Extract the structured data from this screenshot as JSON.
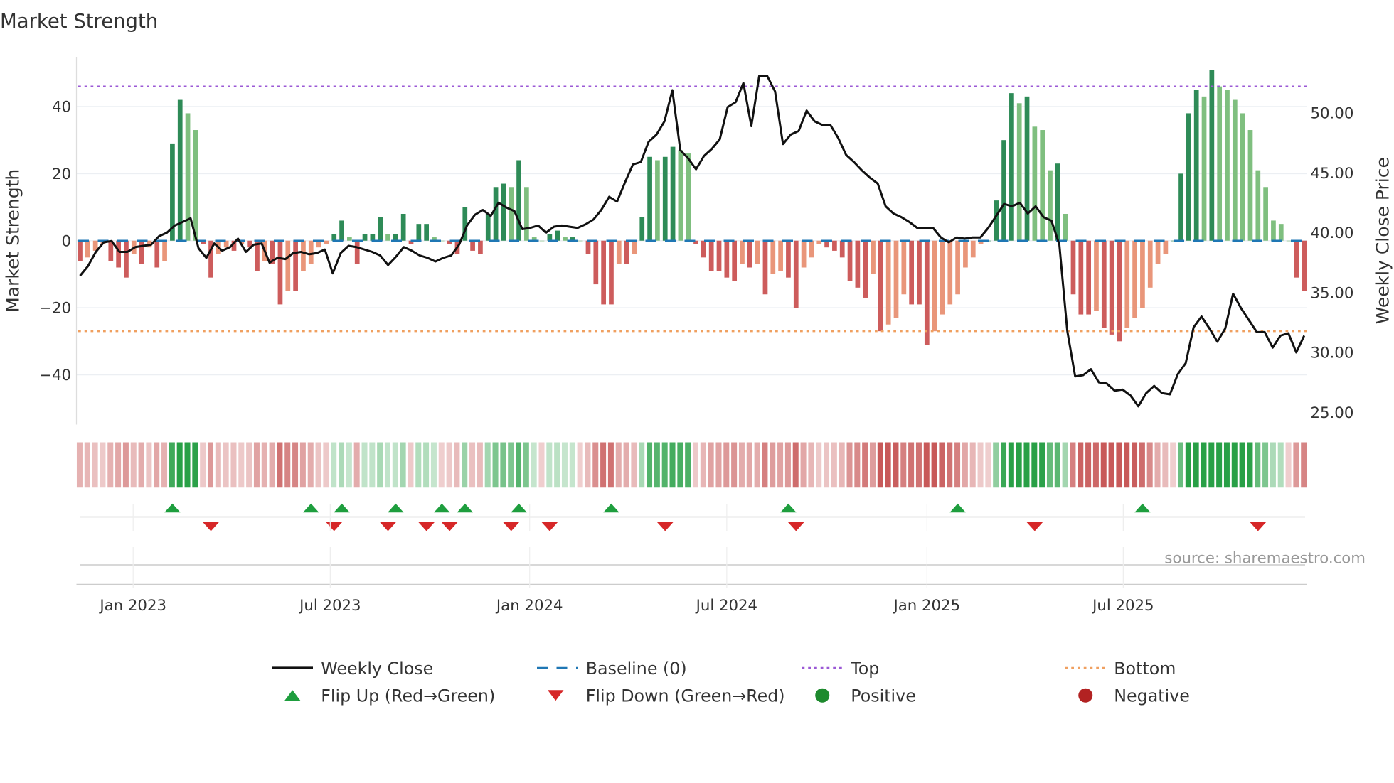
{
  "chart_data": {
    "type": "bar",
    "title": "Market Strength",
    "ylabel": "Market Strength",
    "y2label": "Weekly Close Price",
    "ylim": [
      -55,
      55
    ],
    "y2lim": [
      23.5,
      54
    ],
    "yticks": [
      -40,
      -20,
      0,
      20,
      40
    ],
    "yticklabels": [
      "−40",
      "−20",
      "0",
      "20",
      "40"
    ],
    "y2ticks": [
      25,
      30,
      35,
      40,
      45,
      50
    ],
    "y2ticklabels": [
      "25.00",
      "30.00",
      "35.00",
      "40.00",
      "45.00",
      "50.00"
    ],
    "xticks": [
      {
        "label": "Jan 2023",
        "week": 6.9
      },
      {
        "label": "Jul 2023",
        "week": 32.5
      },
      {
        "label": "Jan 2024",
        "week": 58.4
      },
      {
        "label": "Jul 2024",
        "week": 84.0
      },
      {
        "label": "Jan 2025",
        "week": 110.0
      },
      {
        "label": "Jul 2025",
        "week": 135.5
      }
    ],
    "top_level": 46,
    "bottom_level": -27,
    "strength": [
      -6,
      -5,
      -3,
      -1,
      -6,
      -8,
      -11,
      -4,
      -7,
      -2,
      -8,
      -6,
      29,
      42,
      38,
      33,
      -1,
      -11,
      -4,
      -2,
      -3,
      -1,
      -2,
      -9,
      -6,
      -7,
      -19,
      -15,
      -15,
      -9,
      -7,
      -2,
      -1,
      2,
      6,
      1,
      -7,
      2,
      2,
      7,
      2,
      2,
      8,
      -1,
      5,
      5,
      1,
      0,
      -1,
      -4,
      10,
      -3,
      -4,
      8,
      16,
      17,
      16,
      24,
      16,
      1,
      0,
      2,
      3,
      1,
      1,
      0,
      -4,
      -13,
      -19,
      -19,
      -7,
      -7,
      -4,
      7,
      25,
      24,
      25,
      28,
      27,
      26,
      -1,
      -5,
      -9,
      -9,
      -11,
      -12,
      -7,
      -8,
      -7,
      -16,
      -10,
      -9,
      -11,
      -20,
      -8,
      -5,
      -1,
      -2,
      -3,
      -5,
      -12,
      -14,
      -17,
      -10,
      -27,
      -25,
      -23,
      -16,
      -19,
      -19,
      -31,
      -27,
      -22,
      -19,
      -16,
      -8,
      -5,
      -1,
      0,
      12,
      30,
      44,
      41,
      43,
      34,
      33,
      21,
      23,
      8,
      -16,
      -22,
      -22,
      -21,
      -26,
      -28,
      -30,
      -26,
      -23,
      -20,
      -14,
      -7,
      -4,
      0,
      20,
      38,
      45,
      43,
      51,
      46,
      45,
      42,
      38,
      33,
      21,
      16,
      6,
      5,
      0,
      -11,
      -15
    ],
    "weekly_close": [
      36.4,
      37.2,
      38.4,
      39.2,
      39.3,
      38.4,
      38.4,
      38.8,
      38.9,
      39.0,
      39.7,
      40.0,
      40.6,
      40.9,
      41.2,
      38.7,
      37.9,
      39.1,
      38.5,
      38.8,
      39.5,
      38.4,
      39.0,
      39.1,
      37.5,
      37.9,
      37.8,
      38.3,
      38.4,
      38.2,
      38.3,
      38.6,
      36.6,
      38.3,
      38.9,
      38.8,
      38.6,
      38.4,
      38.1,
      37.3,
      38.0,
      38.8,
      38.5,
      38.1,
      37.9,
      37.6,
      37.9,
      38.1,
      39.0,
      40.6,
      41.5,
      41.9,
      41.4,
      42.5,
      42.1,
      41.8,
      40.3,
      40.4,
      40.6,
      40.0,
      40.5,
      40.6,
      40.5,
      40.4,
      40.7,
      41.1,
      41.9,
      43.0,
      42.6,
      44.2,
      45.7,
      45.9,
      47.6,
      48.2,
      49.3,
      51.9,
      46.9,
      46.2,
      45.3,
      46.4,
      47.0,
      47.8,
      50.5,
      50.9,
      52.5,
      48.9,
      53.1,
      53.1,
      51.8,
      47.4,
      48.2,
      48.5,
      50.2,
      49.3,
      49.0,
      49.0,
      47.9,
      46.5,
      45.9,
      45.2,
      44.6,
      44.1,
      42.2,
      41.6,
      41.3,
      40.9,
      40.4,
      40.4,
      40.4,
      39.6,
      39.2,
      39.6,
      39.5,
      39.6,
      39.6,
      40.4,
      41.4,
      42.4,
      42.2,
      42.5,
      41.6,
      42.2,
      41.3,
      41.0,
      39.0,
      31.8,
      28.0,
      28.1,
      28.6,
      27.5,
      27.4,
      26.8,
      26.9,
      26.4,
      25.5,
      26.6,
      27.2,
      26.6,
      26.5,
      28.2,
      29.1,
      32.1,
      33.0,
      32.0,
      30.9,
      32.0,
      34.9,
      33.7,
      32.7,
      31.7,
      31.7,
      30.4,
      31.4,
      31.6,
      30.0,
      31.4
    ],
    "flip_up_weeks": [
      12,
      30,
      34,
      41,
      47,
      50,
      57,
      69,
      92,
      114,
      138
    ],
    "flip_down_weeks": [
      17,
      33,
      40,
      45,
      48,
      56,
      61,
      76,
      93,
      124,
      153
    ],
    "legend": [
      {
        "label": "Weekly Close",
        "kind": "line",
        "color": "#111111"
      },
      {
        "label": "Baseline (0)",
        "kind": "dash",
        "color": "#1f77b4"
      },
      {
        "label": "Top",
        "kind": "dot",
        "color": "#9b59d6"
      },
      {
        "label": "Bottom",
        "kind": "dot",
        "color": "#f0a060"
      },
      {
        "label": "Flip Up (Red→Green)",
        "kind": "tri-up",
        "color": "#1e9e3e"
      },
      {
        "label": "Flip Down (Green→Red)",
        "kind": "tri-down",
        "color": "#d62728"
      },
      {
        "label": "Positive",
        "kind": "circle",
        "color": "#1e8a2e"
      },
      {
        "label": "Negative",
        "kind": "circle",
        "color": "#b22222"
      }
    ],
    "legend_placement": "bottom",
    "source": "source: sharemaestro.com",
    "colors": {
      "green_dark": "#2e8b57",
      "green_light": "#7fbf7f",
      "red_dark": "#cd5c5c",
      "red_light": "#e9967a",
      "top": "#9b59d6",
      "bottom": "#f0a060",
      "baseline": "#1f77b4"
    }
  }
}
